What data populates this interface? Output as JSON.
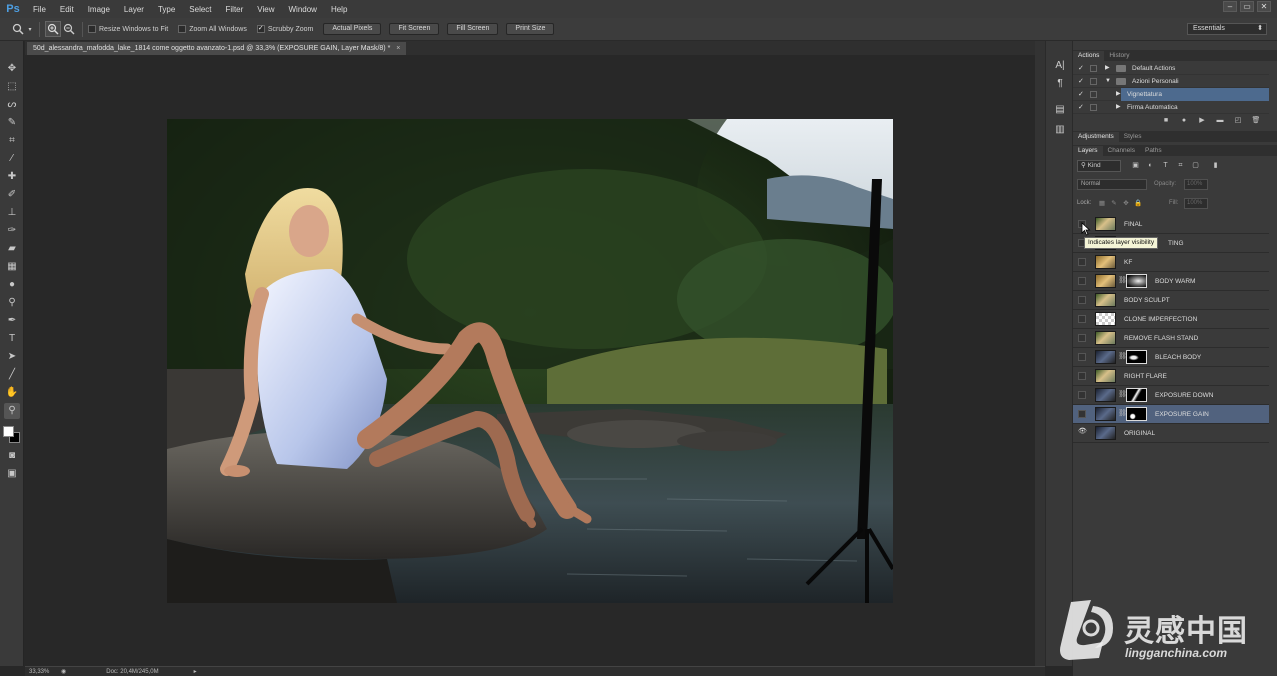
{
  "app": {
    "logo": "Ps",
    "menu": [
      "File",
      "Edit",
      "Image",
      "Layer",
      "Type",
      "Select",
      "Filter",
      "View",
      "Window",
      "Help"
    ],
    "window_controls": [
      "–",
      "▭",
      "✕"
    ]
  },
  "options_bar": {
    "resize_windows": "Resize Windows to Fit",
    "zoom_all_windows": "Zoom All Windows",
    "scrubby_zoom": "Scrubby Zoom",
    "buttons": [
      "Actual Pixels",
      "Fit Screen",
      "Fill Screen",
      "Print Size"
    ],
    "workspace": "Essentials"
  },
  "document": {
    "tab_title": "50d_alessandra_mafodda_lake_1814 come oggetto avanzato-1.psd @ 33,3% (EXPOSURE GAIN, Layer Mask/8) *",
    "close": "×"
  },
  "status": {
    "zoom": "33,33%",
    "doc_size": "Doc: 20,4M/245,0M",
    "arrow": "▸"
  },
  "actions_panel": {
    "tabs": [
      "Actions",
      "History"
    ],
    "items": [
      {
        "label": "Default Actions",
        "checked": "✓"
      },
      {
        "label": "Azioni Personali",
        "checked": "✓"
      },
      {
        "label": "Vignettatura",
        "checked": "✓"
      },
      {
        "label": "Firma Automatica",
        "checked": "✓"
      }
    ]
  },
  "adjustments_panel": {
    "tabs": [
      "Adjustments",
      "Styles"
    ]
  },
  "layers_panel": {
    "tabs": [
      "Layers",
      "Channels",
      "Paths"
    ],
    "kind": "Kind",
    "blend_mode": "Normal",
    "opacity_label": "Opacity:",
    "opacity_value": "100%",
    "lock_label": "Lock:",
    "fill_label": "Fill:",
    "fill_value": "100%",
    "layers": [
      {
        "name": "FINAL"
      },
      {
        "name": "TING"
      },
      {
        "name": "KF"
      },
      {
        "name": "BODY WARM"
      },
      {
        "name": "BODY SCULPT"
      },
      {
        "name": "CLONE IMPERFECTION"
      },
      {
        "name": "REMOVE FLASH STAND"
      },
      {
        "name": "BLEACH BODY"
      },
      {
        "name": "RIGHT FLARE"
      },
      {
        "name": "EXPOSURE DOWN"
      },
      {
        "name": "EXPOSURE GAIN",
        "selected": true
      },
      {
        "name": "ORIGINAL",
        "visible": "👁"
      }
    ],
    "tooltip": "Indicates layer visibility"
  },
  "watermark": {
    "chinese": "灵感中国",
    "url": "lingganchina.com"
  },
  "colors": {
    "accent_selection": "#51627e",
    "ps_logo": "#4d9fe3"
  }
}
